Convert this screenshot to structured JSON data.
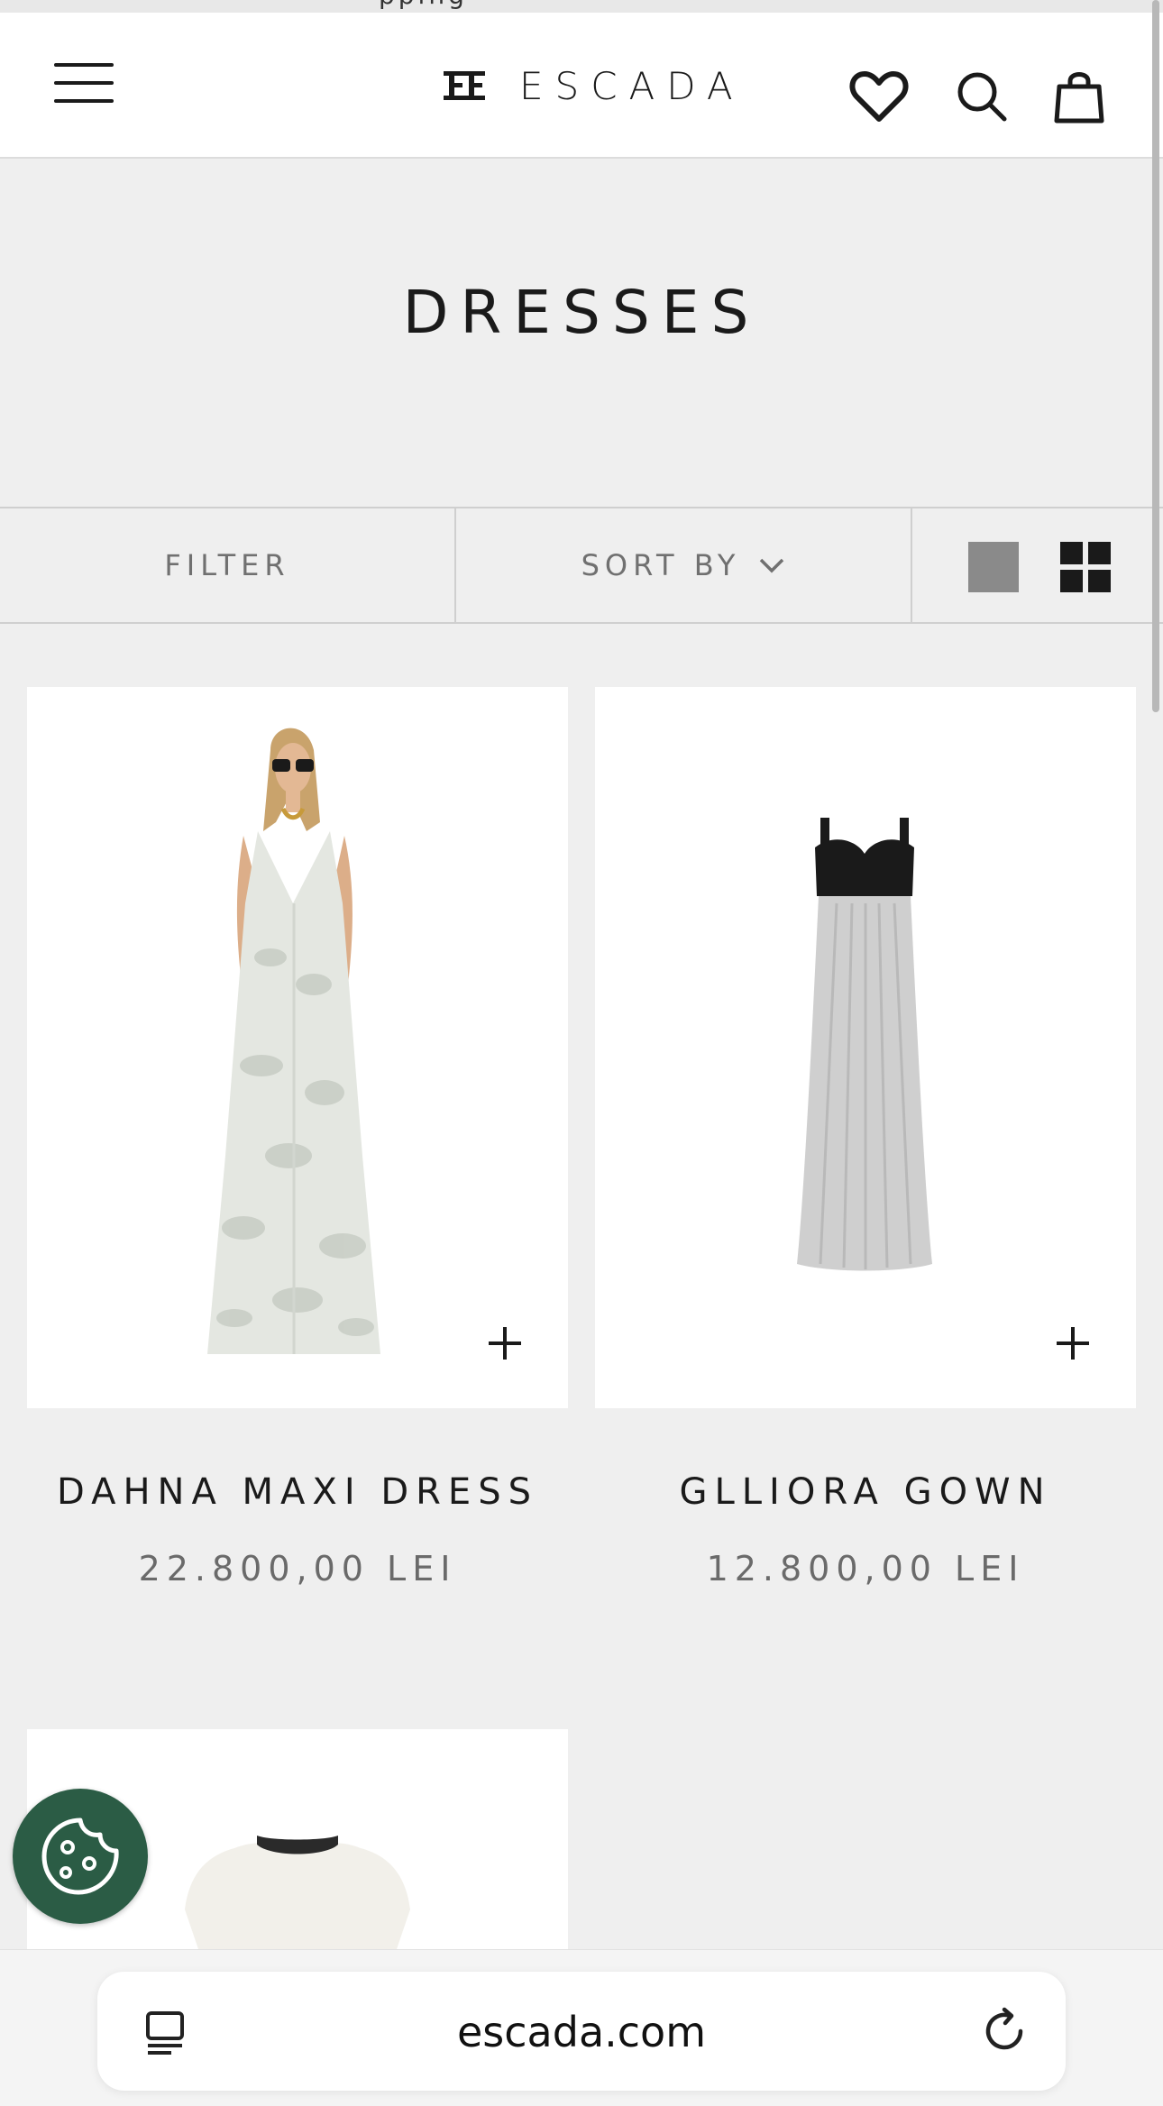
{
  "announcement": {
    "text": "pping"
  },
  "header": {
    "brand": "ESCADA",
    "icons": [
      "menu-icon",
      "heart-icon",
      "search-icon",
      "bag-icon"
    ]
  },
  "page": {
    "title": "DRESSES"
  },
  "toolbar": {
    "filter_label": "FILTER",
    "sort_label": "SORT BY"
  },
  "products": [
    {
      "name": "DAHNA MAXI DRESS",
      "price": "22.800,00 LEI"
    },
    {
      "name": "GLLIORA GOWN",
      "price": "12.800,00 LEI"
    }
  ],
  "browser": {
    "url": "escada.com"
  },
  "colors": {
    "cookie_button": "#2b5c45",
    "background": "#efefef",
    "price_text": "#6a6a6a"
  }
}
